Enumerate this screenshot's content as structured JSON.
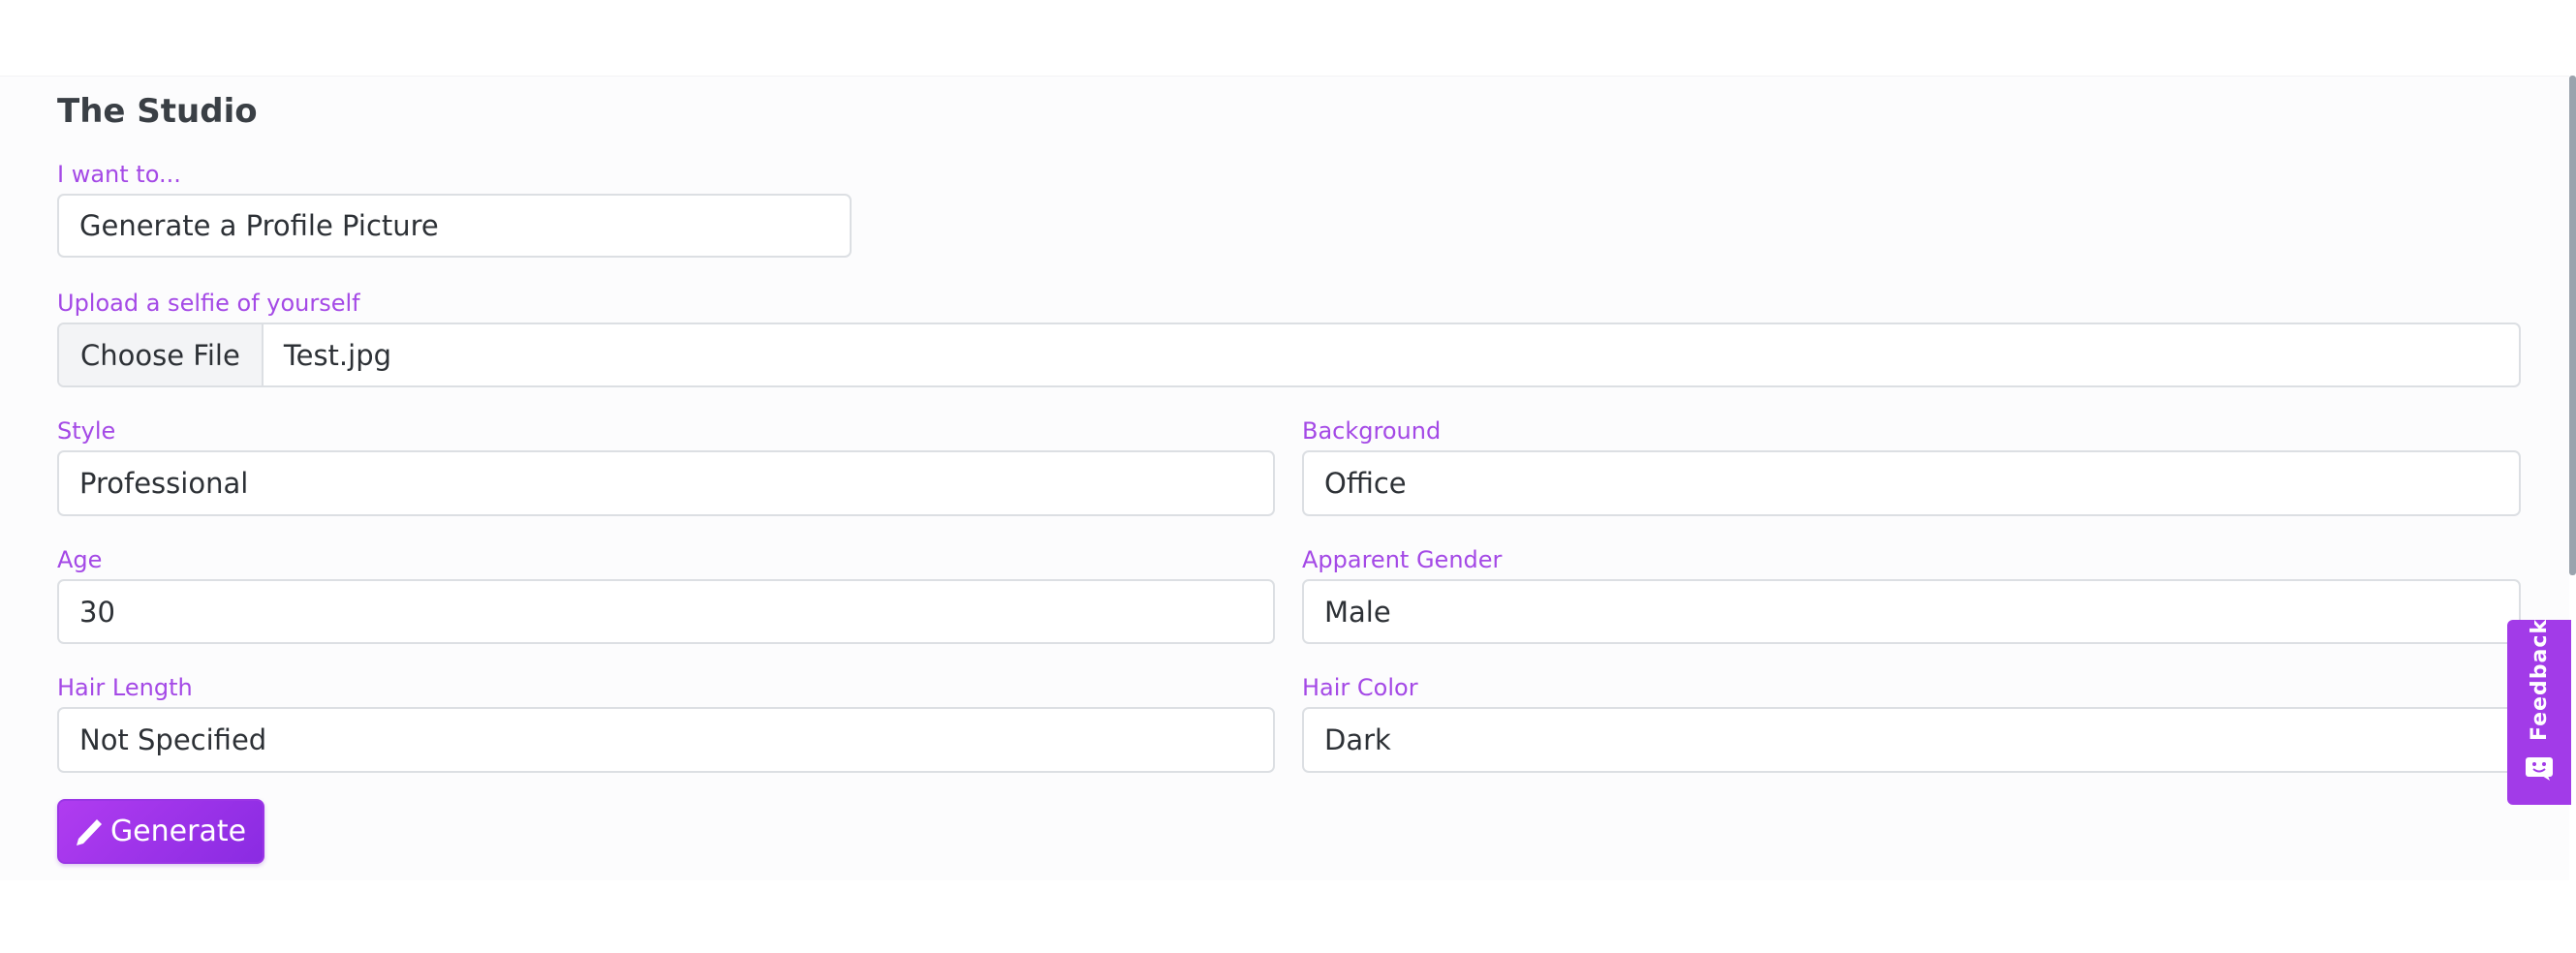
{
  "page": {
    "title": "The Studio"
  },
  "form": {
    "intent": {
      "label": "I want to...",
      "value": "Generate a Profile Picture"
    },
    "selfie": {
      "label": "Upload a selfie of yourself",
      "button_label": "Choose File",
      "file_name": "Test.jpg"
    },
    "style": {
      "label": "Style",
      "value": "Professional"
    },
    "background": {
      "label": "Background",
      "value": "Office"
    },
    "age": {
      "label": "Age",
      "value": "30"
    },
    "gender": {
      "label": "Apparent Gender",
      "value": "Male"
    },
    "hair_length": {
      "label": "Hair Length",
      "value": "Not Specified"
    },
    "hair_color": {
      "label": "Hair Color",
      "value": "Dark"
    },
    "generate_label": "Generate"
  },
  "feedback": {
    "label": "Feedback"
  },
  "colors": {
    "label_accent": "#a449e6",
    "button_gradient_start": "#b03cf0",
    "button_gradient_end": "#8a2be2",
    "feedback_tab": "#a23be8"
  },
  "icons": {
    "generate": "pencil-icon",
    "feedback": "chat-face-icon"
  }
}
